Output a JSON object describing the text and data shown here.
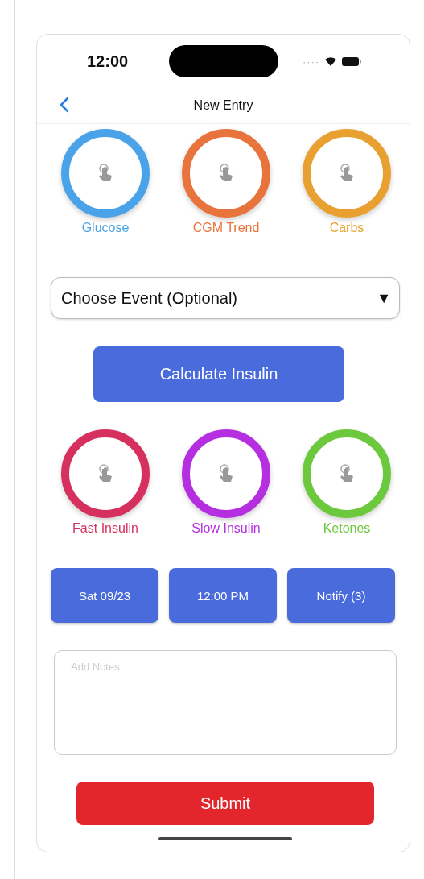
{
  "status_bar": {
    "time": "12:00",
    "signal_dots": "····"
  },
  "nav": {
    "title": "New Entry"
  },
  "top_circles": [
    {
      "label": "Glucose",
      "color": "#4aa3e8"
    },
    {
      "label": "CGM Trend",
      "color": "#e8733c"
    },
    {
      "label": "Carbs",
      "color": "#e8a030"
    }
  ],
  "event_select": {
    "value": "Choose Event (Optional)",
    "caret": "▼"
  },
  "calculate_button": "Calculate Insulin",
  "bottom_circles": [
    {
      "label": "Fast Insulin",
      "color": "#d6305e"
    },
    {
      "label": "Slow Insulin",
      "color": "#b52fe0"
    },
    {
      "label": "Ketones",
      "color": "#6cc83c"
    }
  ],
  "action_buttons": [
    "Sat 09/23",
    "12:00 PM",
    "Notify (3)"
  ],
  "notes": {
    "placeholder": "Add Notes"
  },
  "submit_button": "Submit"
}
